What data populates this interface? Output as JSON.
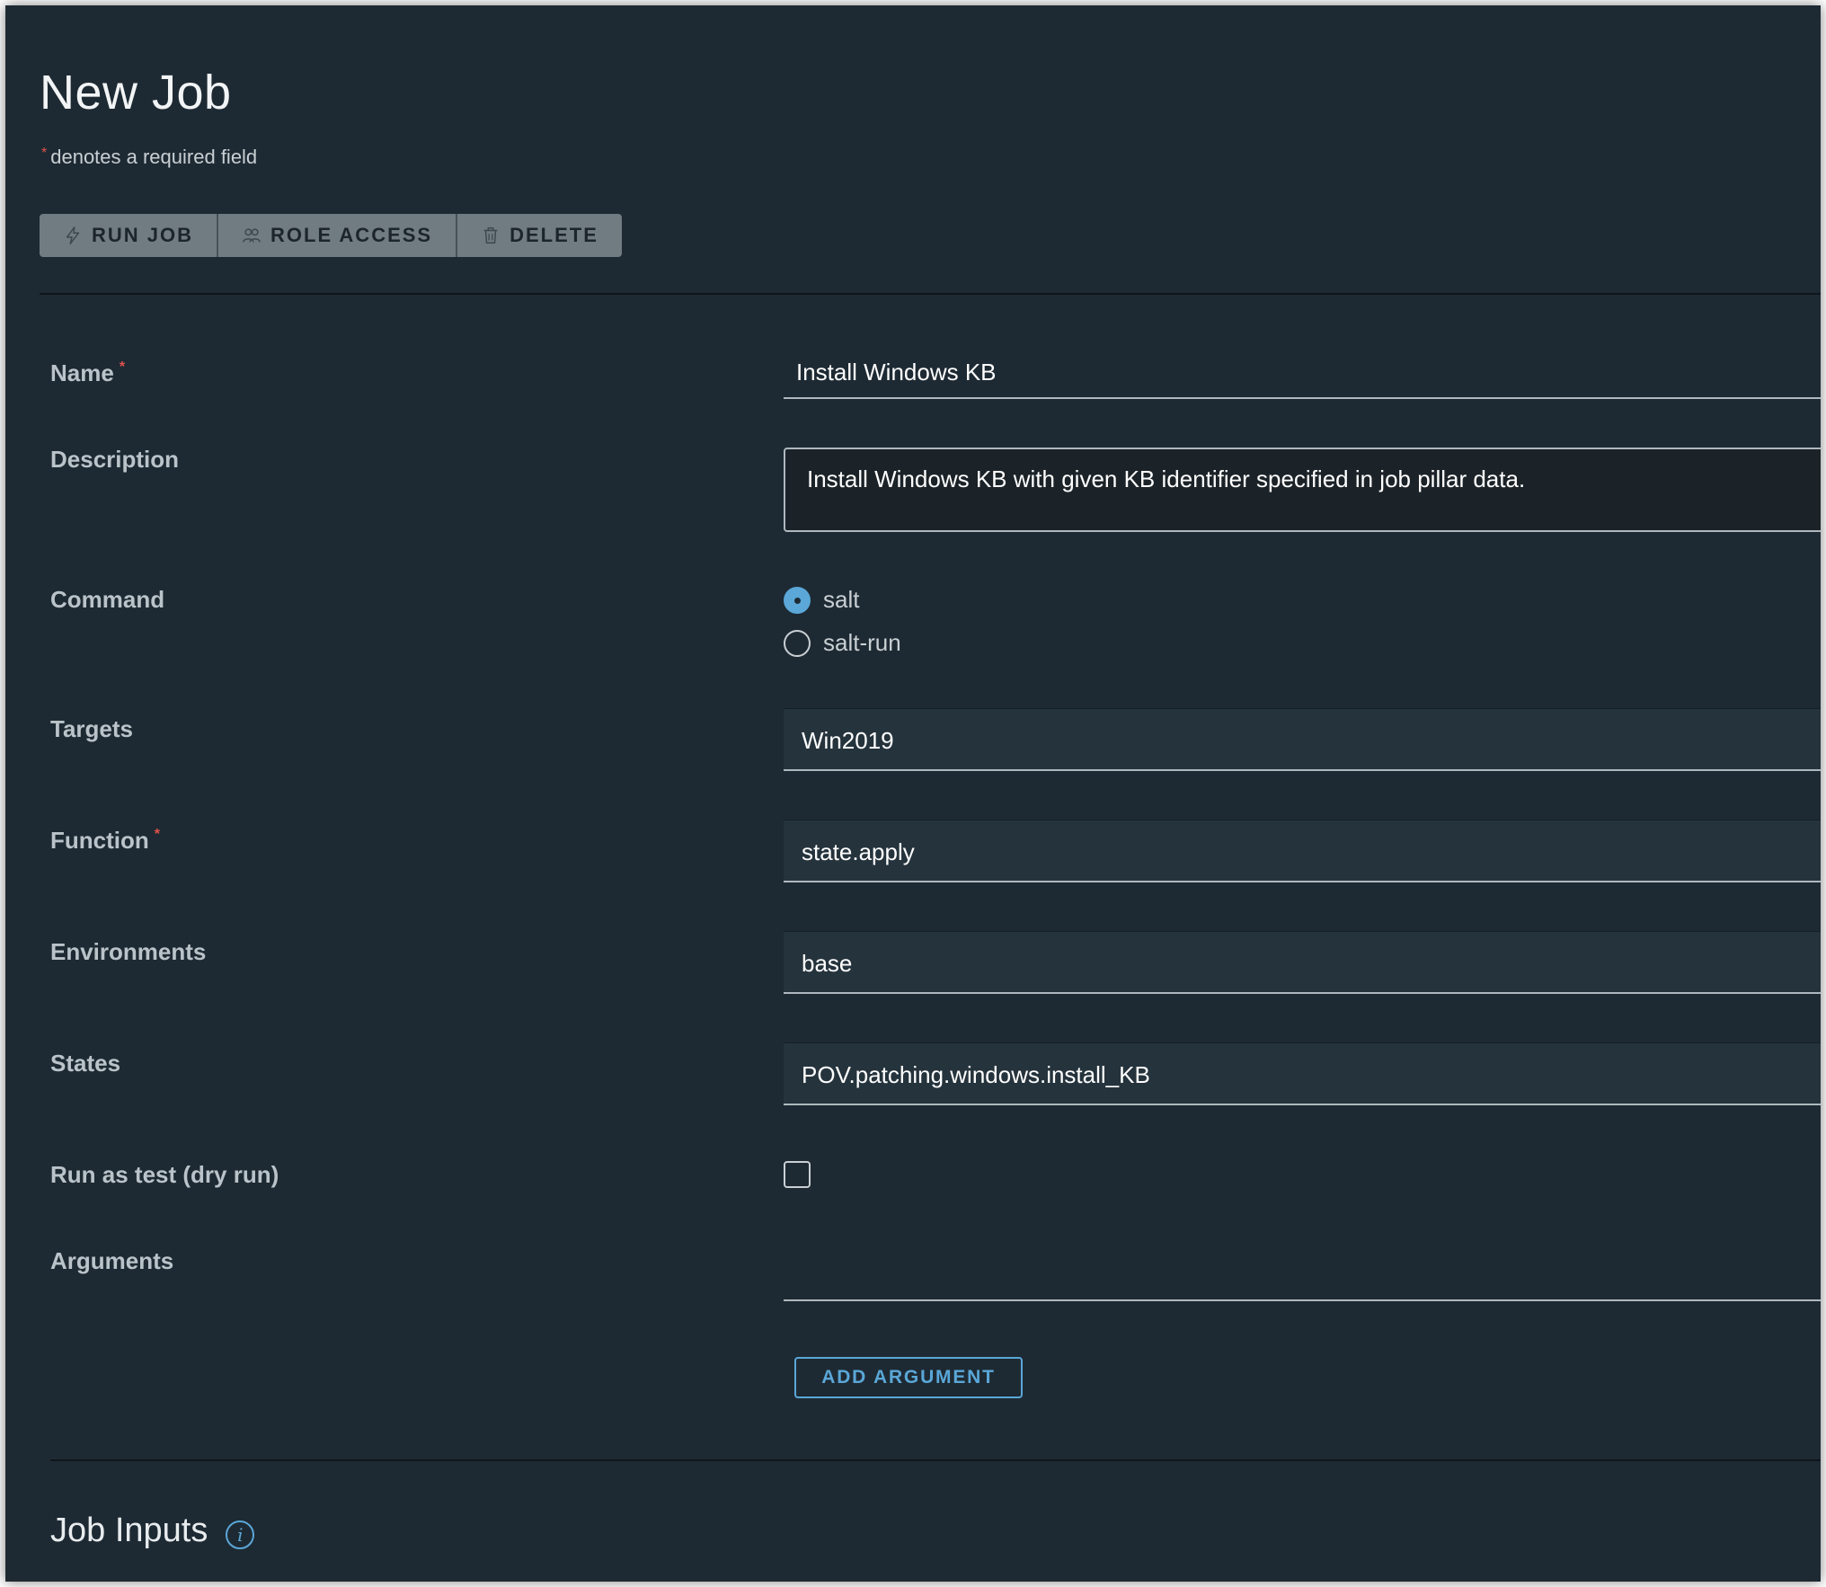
{
  "page": {
    "title": "New Job",
    "required_note": "denotes a required field",
    "required_marker": "*"
  },
  "toolbar": {
    "run_job": "RUN JOB",
    "role_access": "ROLE ACCESS",
    "delete": "DELETE"
  },
  "form": {
    "name": {
      "label": "Name",
      "value": "Install Windows KB",
      "required": true
    },
    "description": {
      "label": "Description",
      "value": "Install Windows KB with given KB identifier specified in job pillar data."
    },
    "command": {
      "label": "Command",
      "options": [
        {
          "label": "salt",
          "selected": true
        },
        {
          "label": "salt-run",
          "selected": false
        }
      ]
    },
    "targets": {
      "label": "Targets",
      "value": "Win2019"
    },
    "function": {
      "label": "Function",
      "value": "state.apply",
      "required": true
    },
    "environments": {
      "label": "Environments",
      "value": "base"
    },
    "states": {
      "label": "States",
      "value": "POV.patching.windows.install_KB"
    },
    "dry_run": {
      "label": "Run as test (dry run)",
      "checked": false
    },
    "arguments": {
      "label": "Arguments",
      "value": "",
      "add_button": "ADD ARGUMENT"
    }
  },
  "job_inputs": {
    "title": "Job Inputs",
    "info_icon": "info-icon"
  },
  "colors": {
    "background": "#1e2a33",
    "accent": "#5aa7d8",
    "required": "#e0524a",
    "toolbar_button": "#717b82"
  }
}
